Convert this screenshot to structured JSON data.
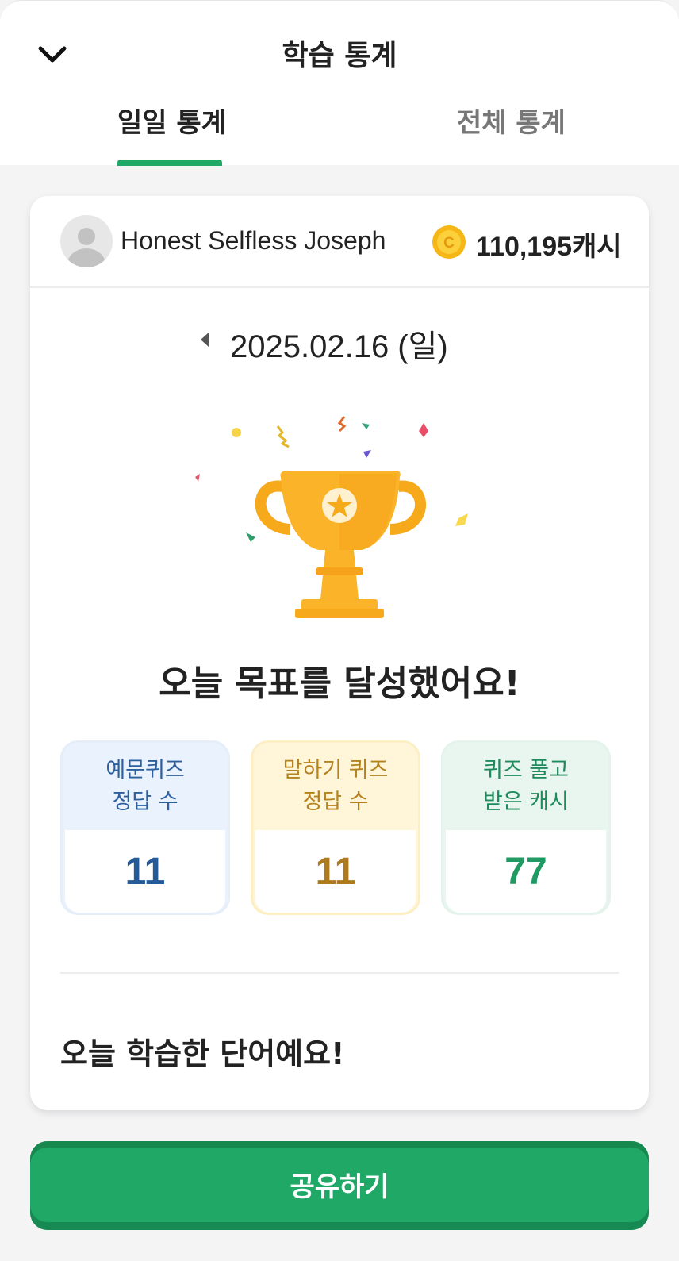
{
  "header": {
    "title": "학습 통계",
    "back_icon": "chevron-down-icon"
  },
  "tabs": [
    {
      "label": "일일 통계",
      "active": true
    },
    {
      "label": "전체 통계",
      "active": false
    }
  ],
  "profile": {
    "username": "Honest Selfless Joseph",
    "cash": "110,195캐시",
    "coin_icon": "coin-icon"
  },
  "date": {
    "text": "2025.02.16 (일)",
    "prev_icon": "caret-left-icon"
  },
  "achievement": {
    "message": "오늘 목표를 달성했어요!",
    "icon": "trophy-icon"
  },
  "stats": [
    {
      "label": "예문퀴즈\n정답 수",
      "value": "11",
      "color": "#255a99"
    },
    {
      "label": "말하기 퀴즈\n정답 수",
      "value": "11",
      "color": "#ad7b1d"
    },
    {
      "label": "퀴즈 풀고\n받은 캐시",
      "value": "77",
      "color": "#1f9a63"
    }
  ],
  "words": {
    "title": "오늘 학습한 단어예요!"
  },
  "share": {
    "label": "공유하기",
    "color": "#1fa866"
  }
}
